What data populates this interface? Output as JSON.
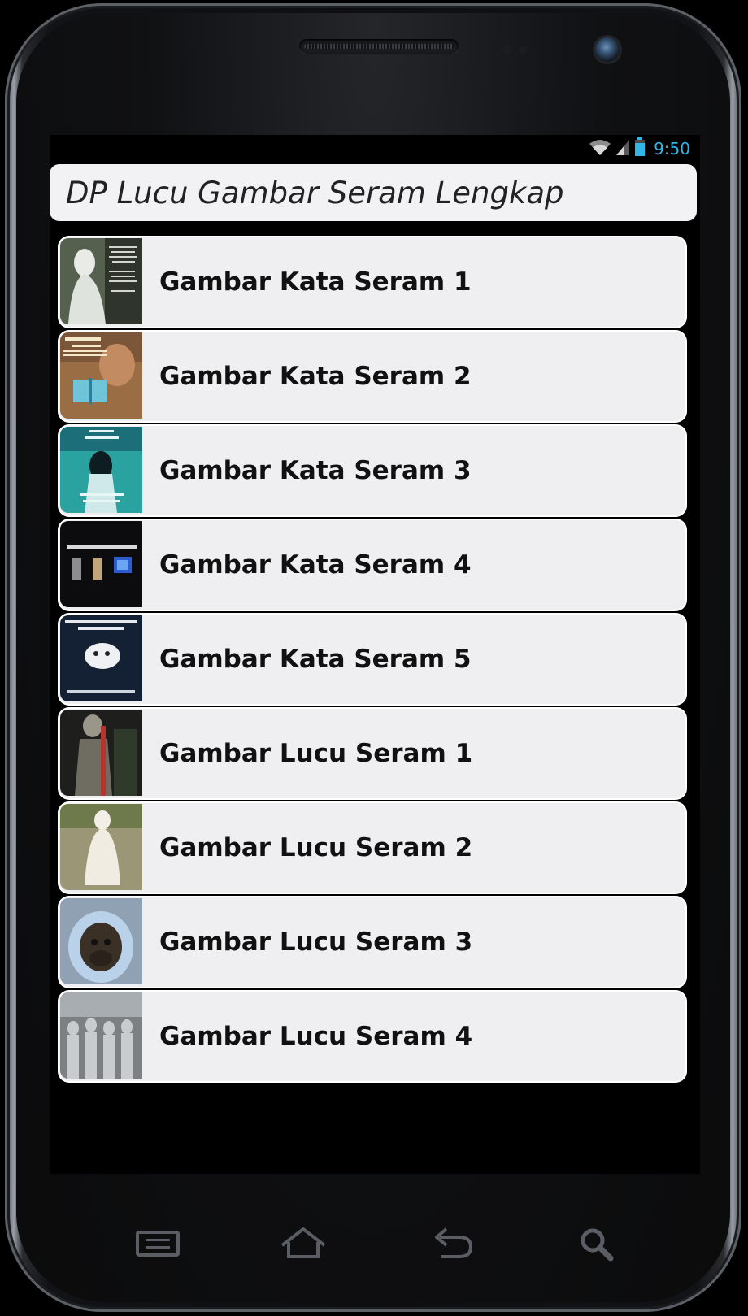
{
  "status": {
    "time": "9:50"
  },
  "app": {
    "title": "DP Lucu Gambar Seram Lengkap"
  },
  "list": {
    "items": [
      {
        "label": "Gambar Kata Seram 1",
        "thumb_bg": "#6f7a66"
      },
      {
        "label": "Gambar Kata Seram 2",
        "thumb_bg": "#8a6a4a"
      },
      {
        "label": "Gambar Kata Seram 3",
        "thumb_bg": "#2fa7a3"
      },
      {
        "label": "Gambar Kata Seram 4",
        "thumb_bg": "#0c0c0e"
      },
      {
        "label": "Gambar Kata Seram 5",
        "thumb_bg": "#1a2230"
      },
      {
        "label": "Gambar Lucu Seram 1",
        "thumb_bg": "#2c2d2a"
      },
      {
        "label": "Gambar Lucu Seram 2",
        "thumb_bg": "#a49c7d"
      },
      {
        "label": "Gambar Lucu Seram 3",
        "thumb_bg": "#7f8fa3"
      },
      {
        "label": "Gambar Lucu Seram 4",
        "thumb_bg": "#6b6e72"
      }
    ]
  },
  "navbar": {
    "icons": [
      "menu-icon",
      "home-icon",
      "back-icon",
      "search-icon"
    ]
  },
  "colors": {
    "status_accent": "#33b5e5",
    "list_item_bg": "#efeff1",
    "appbar_bg": "#f2f2f4"
  }
}
